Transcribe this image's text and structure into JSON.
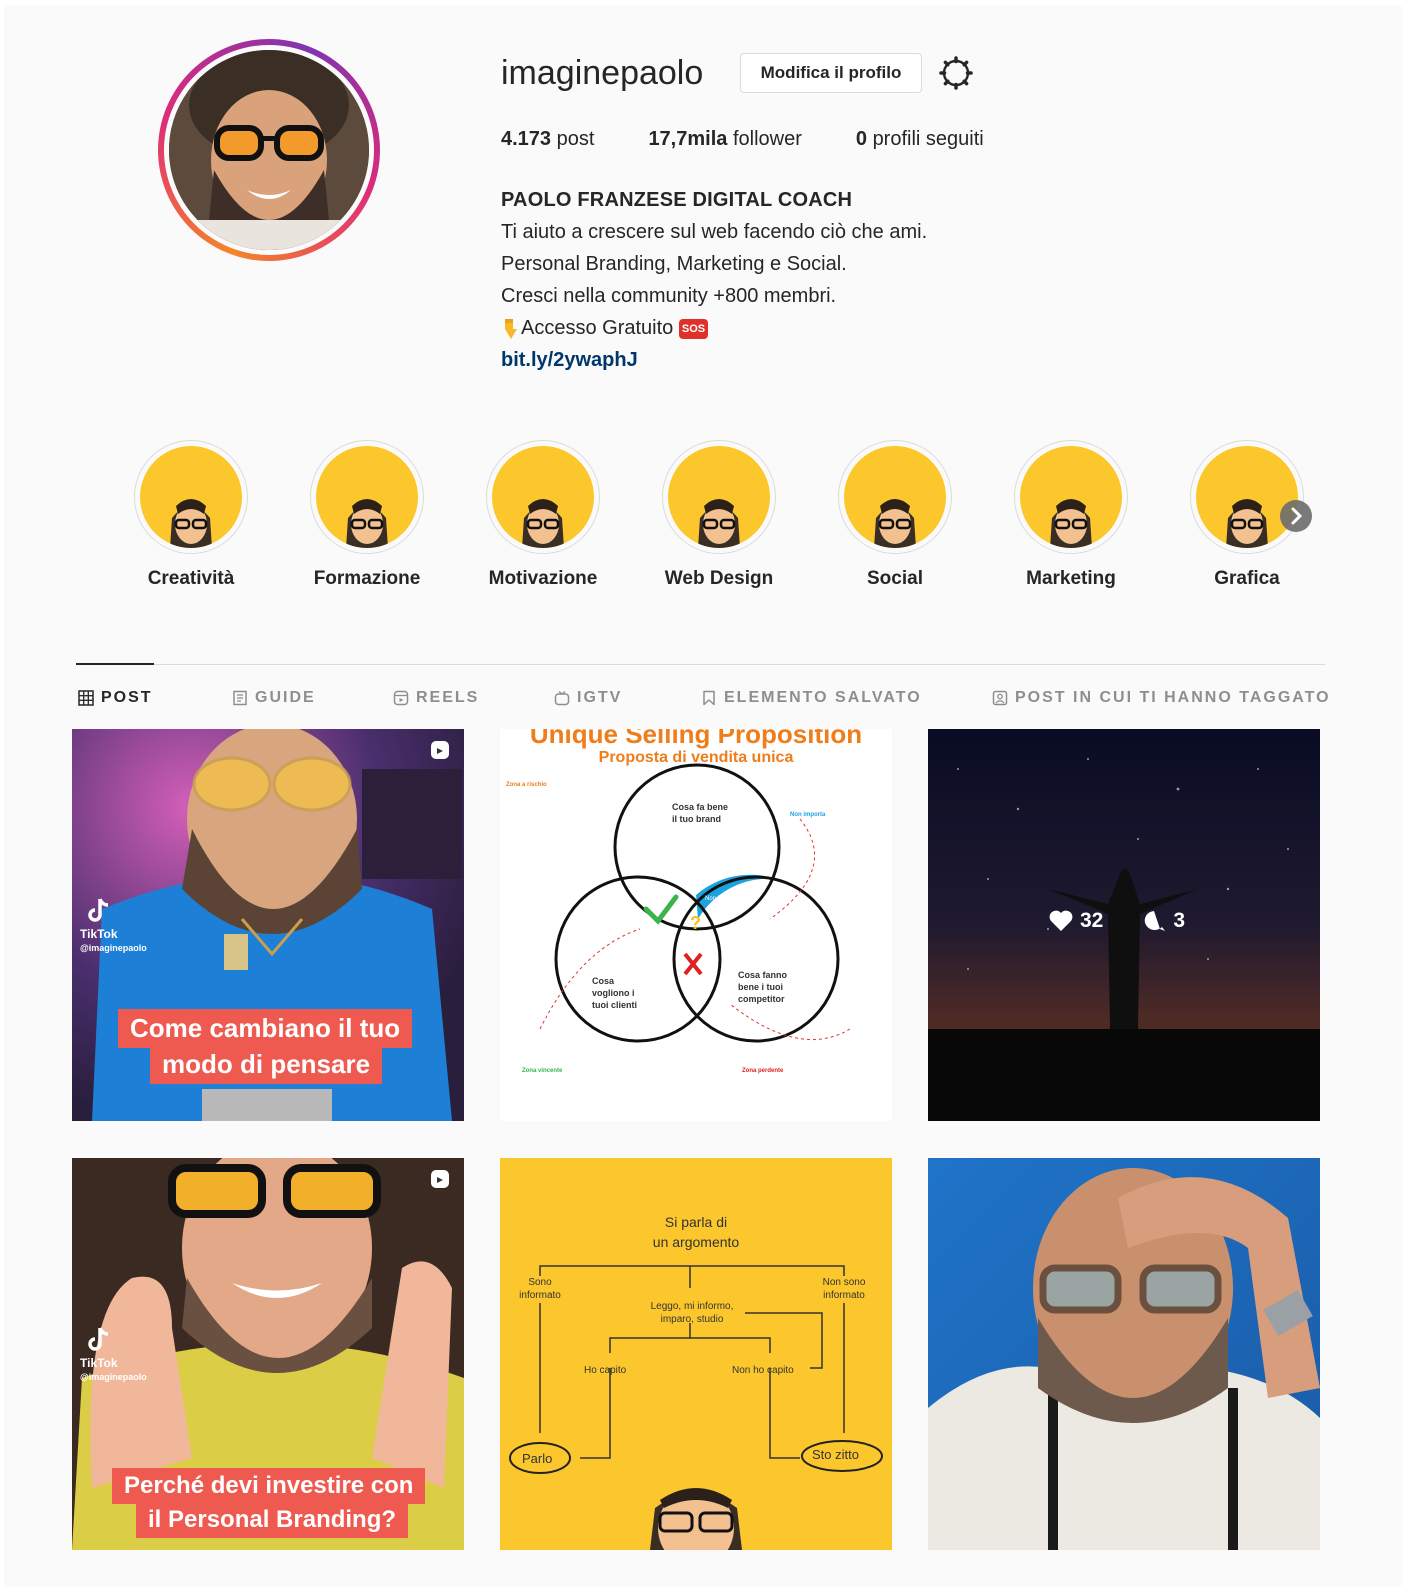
{
  "profile": {
    "username": "imaginepaolo",
    "edit_label": "Modifica il profilo",
    "stats": {
      "posts_num": "4.173",
      "posts_label": "post",
      "followers_num": "17,7mila",
      "followers_label": "follower",
      "following_num": "0",
      "following_label": "profili seguiti"
    },
    "bio": {
      "name": "PAOLO FRANZESE DIGITAL COACH",
      "line1": "Ti aiuto a crescere sul web facendo ciò che ami.",
      "line2": "Personal Branding, Marketing e Social.",
      "line3": "Cresci nella community +800 membri.",
      "line4": "Accesso Gratuito",
      "sos": "SOS",
      "link": "bit.ly/2ywaphJ"
    }
  },
  "highlights": [
    {
      "label": "Creatività"
    },
    {
      "label": "Formazione"
    },
    {
      "label": "Motivazione"
    },
    {
      "label": "Web Design"
    },
    {
      "label": "Social"
    },
    {
      "label": "Marketing"
    },
    {
      "label": "Grafica"
    }
  ],
  "tabs": {
    "post": "POST",
    "guide": "GUIDE",
    "reels": "REELS",
    "igtv": "IGTV",
    "saved": "ELEMENTO SALVATO",
    "tagged": "POST IN CUI TI HANNO TAGGATO"
  },
  "posts": {
    "p1": {
      "caption1": "Come cambiano il tuo",
      "caption2": "modo di pensare",
      "tiktok": "TikTok",
      "handle": "@imaginepaolo"
    },
    "p2": {
      "title": "Unique Selling Proposition",
      "subtitle": "Proposta di vendita unica",
      "c1": "Cosa fa bene il tuo brand",
      "c2": "Cosa vogliono i tuoi clienti",
      "c3": "Cosa fanno bene i tuoi competitor",
      "zone1": "Zona a rischio",
      "zone2": "Non importa",
      "zone3": "Zona vincente",
      "zone4": "Zona perdente",
      "center": "Non importa"
    },
    "p3": {
      "likes": "32",
      "comments": "3"
    },
    "p4": {
      "caption1": "Perché devi investire con",
      "caption2": "il Personal Branding?",
      "tiktok": "TikTok",
      "handle": "@imaginepaolo"
    },
    "p5": {
      "t1": "Si parla di",
      "t2": "un argomento",
      "left": "Sono informato",
      "right": "Non sono informato",
      "mid1": "Leggo, mi informo,",
      "mid2": "imparo, studio",
      "got": "Ho capito",
      "notgot": "Non ho capito",
      "talk": "Parlo",
      "quiet": "Sto zitto"
    }
  },
  "colors": {
    "highlight_bg": "#fcc72c",
    "link": "#00376b",
    "caption_bg": "#ee5a4f"
  }
}
